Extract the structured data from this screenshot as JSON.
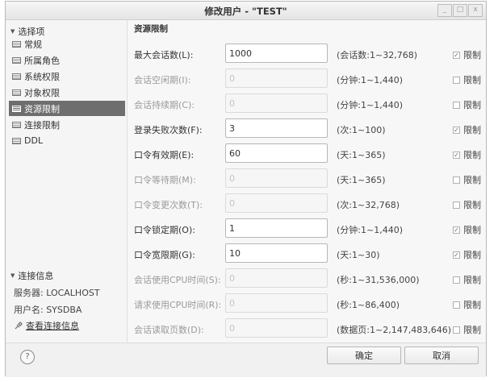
{
  "window": {
    "title": "修改用户 - \"TEST\"",
    "controls": [
      "_",
      "□",
      "x"
    ]
  },
  "sidebar": {
    "section_title": "选择项",
    "items": [
      {
        "label": "常规",
        "icon": "list-icon",
        "selected": false
      },
      {
        "label": "所属角色",
        "icon": "list-icon",
        "selected": false
      },
      {
        "label": "系统权限",
        "icon": "list-icon",
        "selected": false
      },
      {
        "label": "对象权限",
        "icon": "list-icon",
        "selected": false
      },
      {
        "label": "资源限制",
        "icon": "list-icon",
        "selected": true
      },
      {
        "label": "连接限制",
        "icon": "list-icon",
        "selected": false
      },
      {
        "label": "DDL",
        "icon": "list-icon",
        "selected": false
      }
    ],
    "connection": {
      "section_title": "连接信息",
      "server": "服务器: LOCALHOST",
      "user": "用户名: SYSDBA",
      "link_label": "查看连接信息",
      "link_icon": "connection-icon"
    }
  },
  "panel": {
    "title": "资源限制",
    "rows": [
      {
        "label": "最大会话数(L):",
        "value": "1000",
        "hint": "(会话数:1~32,768)",
        "limit": "限制",
        "checked": true
      },
      {
        "label": "会话空闲期(I):",
        "value": "0",
        "hint": "(分钟:1~1,440)",
        "limit": "限制",
        "checked": false
      },
      {
        "label": "会话持续期(C):",
        "value": "0",
        "hint": "(分钟:1~1,440)",
        "limit": "限制",
        "checked": false
      },
      {
        "label": "登录失败次数(F):",
        "value": "3",
        "hint": "(次:1~100)",
        "limit": "限制",
        "checked": true
      },
      {
        "label": "口令有效期(E):",
        "value": "60",
        "hint": "(天:1~365)",
        "limit": "限制",
        "checked": true
      },
      {
        "label": "口令等待期(M):",
        "value": "0",
        "hint": "(天:1~365)",
        "limit": "限制",
        "checked": false
      },
      {
        "label": "口令变更次数(T):",
        "value": "0",
        "hint": "(次:1~32,768)",
        "limit": "限制",
        "checked": false
      },
      {
        "label": "口令锁定期(O):",
        "value": "1",
        "hint": "(分钟:1~1,440)",
        "limit": "限制",
        "checked": true
      },
      {
        "label": "口令宽限期(G):",
        "value": "10",
        "hint": "(天:1~30)",
        "limit": "限制",
        "checked": true
      },
      {
        "label": "会话使用CPU时间(S):",
        "value": "0",
        "hint": "(秒:1~31,536,000)",
        "limit": "限制",
        "checked": false
      },
      {
        "label": "请求使用CPU时间(R):",
        "value": "0",
        "hint": "(秒:1~86,400)",
        "limit": "限制",
        "checked": false
      },
      {
        "label": "会话读取页数(D):",
        "value": "0",
        "hint": "(数据页:1~2,147,483,646)",
        "limit": "限制",
        "checked": false
      }
    ]
  },
  "footer": {
    "help_icon": "help-icon",
    "help_glyph": "?",
    "ok_label": "确定",
    "cancel_label": "取消"
  }
}
